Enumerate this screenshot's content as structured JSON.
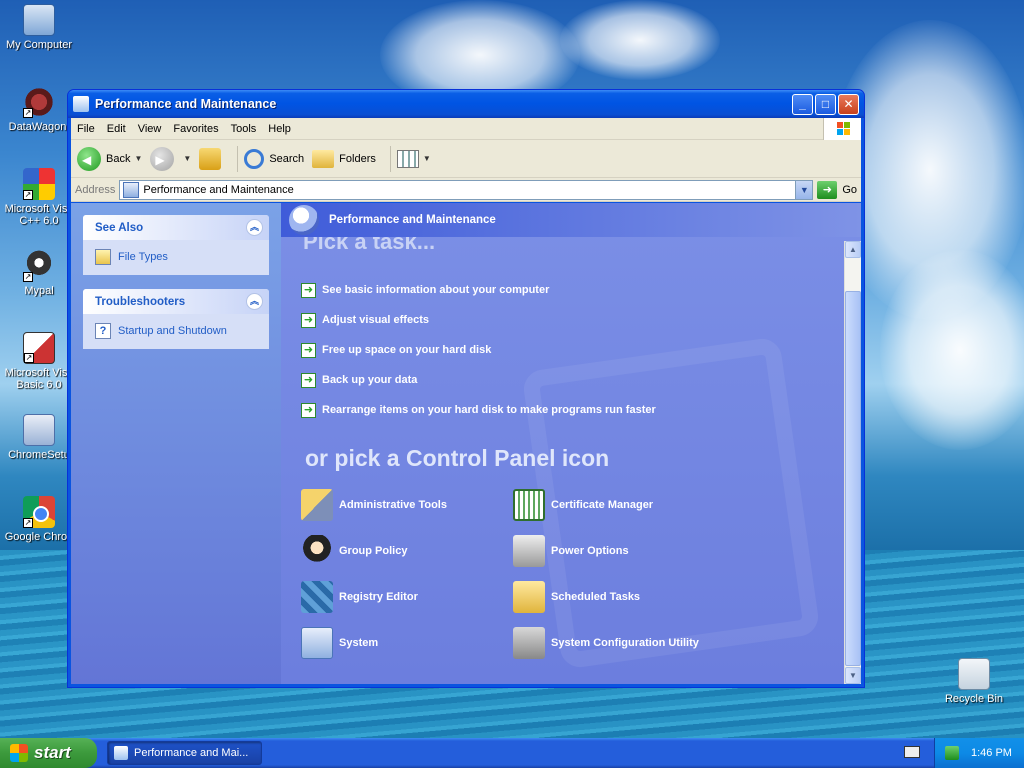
{
  "desktop": {
    "icons": [
      {
        "label": "My Computer"
      },
      {
        "label": "DataWagon."
      },
      {
        "label": "Microsoft Visu",
        "label2": "C++ 6.0"
      },
      {
        "label": "Mypal"
      },
      {
        "label": "Microsoft Visu",
        "label2": "Basic 6.0"
      },
      {
        "label": "ChromeSetu"
      },
      {
        "label": "Google Chron"
      },
      {
        "label": "Recycle Bin"
      }
    ]
  },
  "window": {
    "title": "Performance and Maintenance",
    "menu": [
      "File",
      "Edit",
      "View",
      "Favorites",
      "Tools",
      "Help"
    ],
    "toolbar": {
      "back": "Back",
      "search": "Search",
      "folders": "Folders"
    },
    "address": {
      "label": "Address",
      "value": "Performance and Maintenance",
      "go": "Go"
    },
    "see_also": {
      "title": "See Also",
      "items": [
        "File Types"
      ]
    },
    "troubleshooters": {
      "title": "Troubleshooters",
      "items": [
        "Startup and Shutdown"
      ]
    },
    "main": {
      "header": "Performance and Maintenance",
      "pick_task": "Pick a task...",
      "tasks": [
        "See basic information about your computer",
        "Adjust visual effects",
        "Free up space on your hard disk",
        "Back up your data",
        "Rearrange items on your hard disk to make programs run faster"
      ],
      "or_pick": "or pick a Control Panel icon",
      "icons": [
        "Administrative Tools",
        "Certificate Manager",
        "Group Policy",
        "Power Options",
        "Registry Editor",
        "Scheduled Tasks",
        "System",
        "System Configuration Utility"
      ]
    }
  },
  "taskbar": {
    "start": "start",
    "item": "Performance and Mai...",
    "clock": "1:46 PM"
  }
}
